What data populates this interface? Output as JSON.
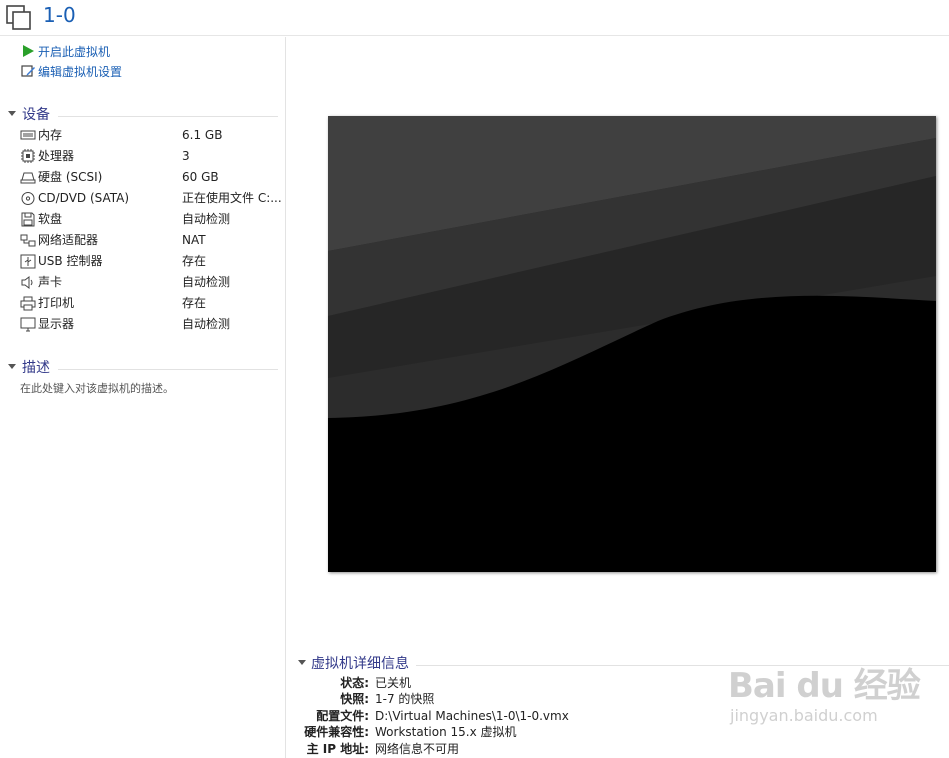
{
  "header": {
    "title": "1-0"
  },
  "actions": {
    "power_on": "开启此虚拟机",
    "edit_settings": "编辑虚拟机设置"
  },
  "devices": {
    "heading": "设备",
    "items": [
      {
        "icon": "memory-icon",
        "name": "内存",
        "value": "6.1 GB"
      },
      {
        "icon": "processor-icon",
        "name": "处理器",
        "value": "3"
      },
      {
        "icon": "hard-disk-icon",
        "name": "硬盘 (SCSI)",
        "value": "60 GB"
      },
      {
        "icon": "cd-dvd-icon",
        "name": "CD/DVD (SATA)",
        "value": "正在使用文件 C:..."
      },
      {
        "icon": "floppy-icon",
        "name": "软盘",
        "value": "自动检测"
      },
      {
        "icon": "network-adapter-icon",
        "name": "网络适配器",
        "value": "NAT"
      },
      {
        "icon": "usb-icon",
        "name": "USB 控制器",
        "value": "存在"
      },
      {
        "icon": "speaker-icon",
        "name": "声卡",
        "value": "自动检测"
      },
      {
        "icon": "printer-icon",
        "name": "打印机",
        "value": "存在"
      },
      {
        "icon": "monitor-icon",
        "name": "显示器",
        "value": "自动检测"
      }
    ]
  },
  "description": {
    "heading": "描述",
    "placeholder": "在此处键入对该虚拟机的描述。"
  },
  "details": {
    "heading": "虚拟机详细信息",
    "rows": [
      {
        "key": "状态:",
        "value": "已关机"
      },
      {
        "key": "快照:",
        "value": "1-7 的快照"
      },
      {
        "key": "配置文件:",
        "value": "D:\\Virtual Machines\\1-0\\1-0.vmx"
      },
      {
        "key": "硬件兼容性:",
        "value": "Workstation 15.x 虚拟机"
      },
      {
        "key": "主 IP 地址:",
        "value": "网络信息不可用"
      }
    ]
  },
  "watermark": {
    "brand": "Bai du 经验",
    "url": "jingyan.baidu.com"
  },
  "colors": {
    "link": "#1a5fb4",
    "section": "#333a8a",
    "play": "#2aa02a"
  }
}
